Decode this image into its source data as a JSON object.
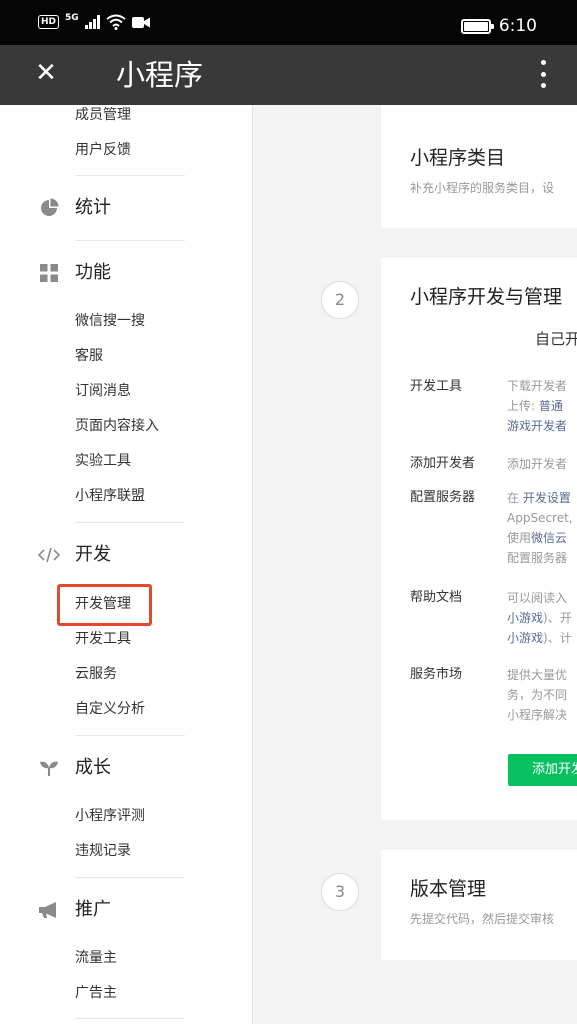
{
  "status_bar": {
    "hd": "HD",
    "network": "5G",
    "time": "6:10"
  },
  "title_bar": {
    "title": "小程序",
    "close_glyph": "✕"
  },
  "sidebar": {
    "top_items": [
      "成员管理",
      "用户反馈"
    ],
    "sections": [
      {
        "icon": "pie-chart-icon",
        "label": "统计",
        "items": []
      },
      {
        "icon": "grid-icon",
        "label": "功能",
        "items": [
          "微信搜一搜",
          "客服",
          "订阅消息",
          "页面内容接入",
          "实验工具",
          "小程序联盟"
        ]
      },
      {
        "icon": "code-icon",
        "label": "开发",
        "items": [
          "开发管理",
          "开发工具",
          "云服务",
          "自定义分析"
        ]
      },
      {
        "icon": "sprout-icon",
        "label": "成长",
        "items": [
          "小程序评测",
          "违规记录"
        ]
      },
      {
        "icon": "megaphone-icon",
        "label": "推广",
        "items": [
          "流量主",
          "广告主"
        ]
      }
    ],
    "highlighted_item": "开发管理"
  },
  "content": {
    "category_card": {
      "title": "小程序类目",
      "subtitle": "补充小程序的服务类目，设"
    },
    "dev_card": {
      "step": "2",
      "title": "小程序开发与管理",
      "tab": "自己开",
      "rows": [
        {
          "label": "开发工具",
          "lines": [
            [
              {
                "t": "下载开发者"
              }
            ],
            [
              {
                "t": "上传:  "
              },
              {
                "t": "普通",
                "link": true
              }
            ],
            [
              {
                "t": "游戏开发者",
                "link": true
              }
            ]
          ]
        },
        {
          "label": "添加开发者",
          "lines": [
            [
              {
                "t": "添加开发者"
              }
            ]
          ]
        },
        {
          "label": "配置服务器",
          "lines": [
            [
              {
                "t": "在 "
              },
              {
                "t": "开发设置",
                "link": true
              }
            ],
            [
              {
                "t": "AppSecret,"
              }
            ],
            [
              {
                "t": "使用"
              },
              {
                "t": "微信云",
                "link": true
              }
            ],
            [
              {
                "t": "配置服务器"
              }
            ]
          ]
        },
        {
          "label": "帮助文档",
          "lines": [
            [
              {
                "t": "可以阅读入"
              }
            ],
            [
              {
                "t": "小游戏",
                "link": true
              },
              {
                "t": ")、开"
              }
            ],
            [
              {
                "t": "小游戏",
                "link": true
              },
              {
                "t": ")、计"
              }
            ]
          ]
        },
        {
          "label": "服务市场",
          "lines": [
            [
              {
                "t": "提供大量优"
              }
            ],
            [
              {
                "t": "务，为不同"
              }
            ],
            [
              {
                "t": "小程序解决"
              }
            ]
          ]
        }
      ],
      "button": "添加开发"
    },
    "version_card": {
      "step": "3",
      "title": "版本管理",
      "subtitle": "先提交代码，然后提交审核"
    }
  }
}
